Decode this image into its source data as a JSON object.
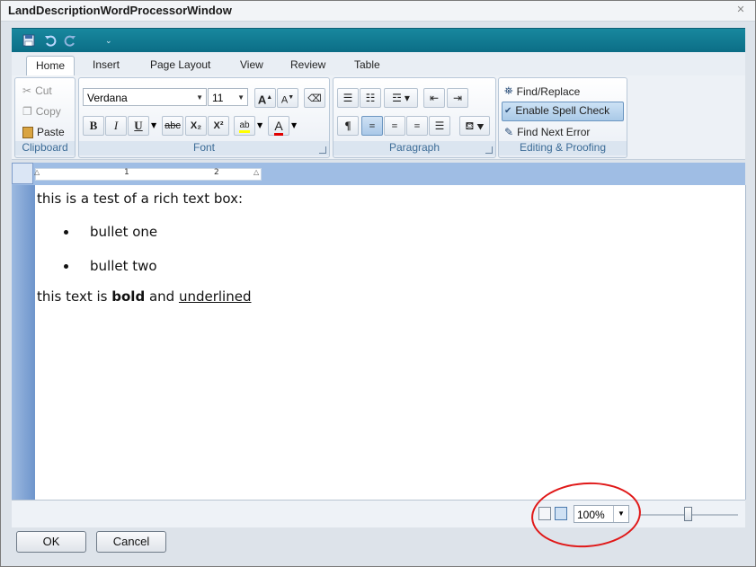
{
  "window": {
    "title": "LandDescriptionWordProcessorWindow"
  },
  "tabs": [
    {
      "label": "Home"
    },
    {
      "label": "Insert"
    },
    {
      "label": "Page Layout"
    },
    {
      "label": "View"
    },
    {
      "label": "Review"
    },
    {
      "label": "Table"
    }
  ],
  "clipboard": {
    "group_label": "Clipboard",
    "cut": "Cut",
    "copy": "Copy",
    "paste": "Paste"
  },
  "font": {
    "group_label": "Font",
    "family": "Verdana",
    "size": "11",
    "bold": "B",
    "italic": "I",
    "underline": "U",
    "strike": "abc",
    "subscript": "X₂",
    "superscript": "X²",
    "highlight": "ab",
    "color_a": "A",
    "grow": "A",
    "shrink": "A"
  },
  "paragraph": {
    "group_label": "Paragraph",
    "pilcrow": "¶"
  },
  "editing": {
    "group_label": "Editing & Proofing",
    "find_replace": "Find/Replace",
    "spell_check": "Enable Spell Check",
    "find_next_error": "Find Next Error"
  },
  "ruler": {
    "marks": [
      "1",
      "2"
    ]
  },
  "document": {
    "line1": "this is a test of a rich text box:",
    "bullets": [
      "bullet one",
      "bullet two"
    ],
    "line2_prefix": "this text is ",
    "line2_bold": "bold",
    "line2_mid": " and ",
    "line2_underlined": "underlined"
  },
  "status": {
    "zoom_value": "100%",
    "zoom_slider_fraction": 0.5
  },
  "buttons": {
    "ok": "OK",
    "cancel": "Cancel"
  },
  "colors": {
    "accent": "#0b6c85",
    "annotation": "#e01818",
    "highlight": "#ffff00",
    "font_color": "#e00000"
  }
}
